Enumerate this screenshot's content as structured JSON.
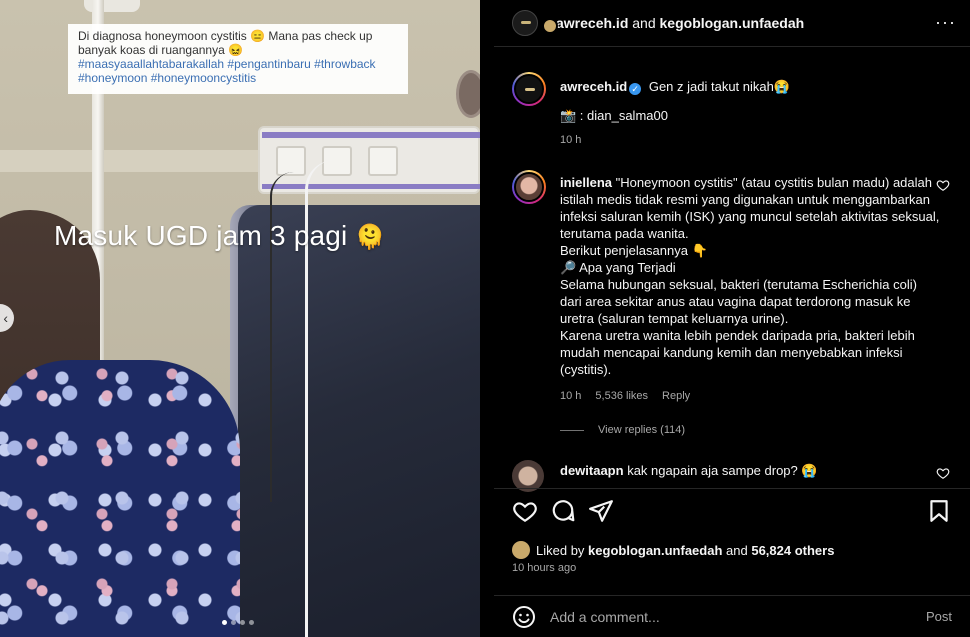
{
  "media": {
    "caption_text": "Di diagnosa honeymoon cystitis 😑 Mana pas check up banyak koas di ruangannya 😖",
    "caption_tags": "#maasyaaallahtabarakallah #pengantinbaru #throwback #honeymoon #honeymooncystitis",
    "overlay_text": "Masuk UGD jam 3 pagi",
    "overlay_emoji": "🫠",
    "prev_icon": "chevron-left-icon",
    "carousel_dots": 4,
    "carousel_active": 0
  },
  "header": {
    "author": "awreceh.id",
    "and_text": "and",
    "collaborator": "kegoblogan.unfaedah",
    "more_icon": "more-horizontal-icon",
    "more_glyph": "···"
  },
  "post_caption": {
    "username": "awreceh.id",
    "text": "Gen z jadi takut nikah😭",
    "credit": "📸 : dian_salma00",
    "time": "10 h"
  },
  "comments": [
    {
      "username": "iniellena",
      "paragraphs": [
        "\"Honeymoon cystitis\" (atau cystitis bulan madu) adalah istilah medis tidak resmi yang digunakan untuk menggambarkan infeksi saluran kemih (ISK) yang muncul setelah aktivitas seksual, terutama pada wanita.",
        "Berikut penjelasannya 👇",
        "🔎 Apa yang Terjadi",
        "Selama hubungan seksual, bakteri (terutama Escherichia coli) dari area sekitar anus atau vagina dapat terdorong masuk ke uretra (saluran tempat keluarnya urine).",
        "Karena uretra wanita lebih pendek daripada pria, bakteri lebih mudah mencapai kandung kemih dan menyebabkan infeksi (cystitis)."
      ],
      "time": "10 h",
      "likes": "5,536 likes",
      "reply_label": "Reply",
      "view_replies": "View replies (114)"
    },
    {
      "username": "dewitaapn",
      "text": "kak ngapain aja sampe drop? 😭"
    }
  ],
  "actions": {
    "like_icon": "heart-icon",
    "comment_icon": "comment-icon",
    "share_icon": "share-icon",
    "save_icon": "bookmark-icon"
  },
  "likes": {
    "prefix": "Liked by",
    "user": "kegoblogan.unfaedah",
    "and_text": "and",
    "others": "56,824 others",
    "time_ago": "10 hours ago"
  },
  "comment_box": {
    "emoji_icon": "emoji-icon",
    "placeholder": "Add a comment...",
    "post_label": "Post"
  },
  "colors": {
    "background": "#000000",
    "text": "#f5f5f5",
    "muted": "#a8a8a8",
    "verified": "#3897f0",
    "hashtag": "#3b6fb3"
  }
}
